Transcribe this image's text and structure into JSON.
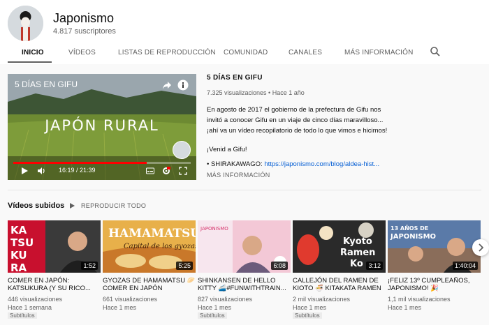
{
  "channel": {
    "name": "Japonismo",
    "subscribers": "4.817 suscriptores"
  },
  "tabs": [
    {
      "label": "INICIO",
      "active": true
    },
    {
      "label": "VÍDEOS"
    },
    {
      "label": "LISTAS DE REPRODUCCIÓN"
    },
    {
      "label": "COMUNIDAD"
    },
    {
      "label": "CANALES"
    },
    {
      "label": "MÁS INFORMACIÓN"
    }
  ],
  "featured": {
    "overlay_title": "5 DÍAS EN GIFU",
    "center_text": "JAPÓN RURAL",
    "time": "16:19 / 21:39",
    "progress": 0.75,
    "title": "5 DÍAS EN GIFU",
    "meta": "7.325 visualizaciones • Hace 1 año",
    "desc1": "En agosto de 2017 el gobierno de la prefectura de Gifu nos invitó a conocer Gifu en un viaje de cinco días maravilloso... ¡ahí va un vídeo recopilatorio de todo lo que vimos e hicimos!",
    "desc2": "¡Venid a Gifu!",
    "link_prefix": "• SHIRAKAWAGO: ",
    "link": "https://japonismo.com/blog/aldea-hist...",
    "more": "MÁS INFORMACIÓN"
  },
  "uploads": {
    "title": "Vídeos subidos",
    "play_all": "REPRODUCIR TODO",
    "videos": [
      {
        "title": "COMER EN JAPÓN: KATSUKURA (Y SU RICO...",
        "views": "446 visualizaciones",
        "age": "Hace 1 semana",
        "badge": "Subtítulos",
        "duration": "1:52",
        "thumb_text": "KATSUKURA"
      },
      {
        "title": "GYOZAS DE HAMAMATSU 🥟COMER EN JAPÓN",
        "views": "661 visualizaciones",
        "age": "Hace 1 mes",
        "badge": "",
        "duration": "5:25",
        "thumb_text": "HAMAMATSU"
      },
      {
        "title": "SHINKANSEN DE HELLO KITTY 🚄#FUNWITHTRAIN...",
        "views": "827 visualizaciones",
        "age": "Hace 1 mes",
        "badge": "Subtítulos",
        "duration": "6:08",
        "thumb_text": "JAPONISMO"
      },
      {
        "title": "CALLEJÓN DEL RAMEN DE KIOTO 🍜 KITAKATA RAMEN",
        "views": "2 mil visualizaciones",
        "age": "Hace 1 mes",
        "badge": "Subtítulos",
        "duration": "3:12",
        "thumb_text": "Kyoto Ramen Ko"
      },
      {
        "title": "¡FELIZ 13º CUMPLEAÑOS, JAPONISMO! 🎉",
        "views": "1,1 mil visualizaciones",
        "age": "Hace 1 mes",
        "badge": "",
        "duration": "1:40:04",
        "thumb_text": "13 AÑOS DE JAPONISMO"
      }
    ]
  },
  "colors": {
    "accent": "#ff0000",
    "link": "#065fd4",
    "text_secondary": "#606060"
  }
}
